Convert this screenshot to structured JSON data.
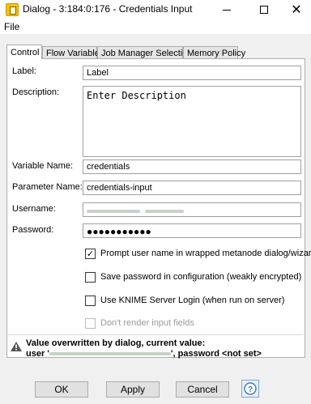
{
  "window": {
    "title": "Dialog - 3:184:0:176 - Credentials Input"
  },
  "menu": {
    "file": "File"
  },
  "tabs": [
    {
      "label": "Control"
    },
    {
      "label": "Flow Variables"
    },
    {
      "label": "Job Manager Selection"
    },
    {
      "label": "Memory Policy"
    }
  ],
  "form": {
    "label": {
      "label": "Label:",
      "value": "Label"
    },
    "description": {
      "label": "Description:",
      "value": "Enter Description"
    },
    "variable_name": {
      "label": "Variable Name:",
      "value": "credentials"
    },
    "parameter_name": {
      "label": "Parameter Name:",
      "value": "credentials-input"
    },
    "username": {
      "label": "Username:"
    },
    "password": {
      "label": "Password:",
      "value": "●●●●●●●●●●●"
    }
  },
  "options": [
    {
      "label": "Prompt user name in wrapped metanode dialog/wizard",
      "checked": true,
      "disabled": false
    },
    {
      "label": "Save password in configuration (weakly encrypted)",
      "checked": false,
      "disabled": false
    },
    {
      "label": "Use KNIME Server Login (when run on server)",
      "checked": false,
      "disabled": false
    },
    {
      "label": "Don't render input fields",
      "checked": false,
      "disabled": true
    }
  ],
  "warning": {
    "line1": "Value overwritten by dialog, current value:",
    "prefix": "user '",
    "suffix": "', password <not set>"
  },
  "buttons": {
    "ok": "OK",
    "apply": "Apply",
    "cancel": "Cancel"
  },
  "icons": {
    "app": "dialog-app-icon",
    "warning": "warning-triangle-icon",
    "help": "help-question-icon"
  }
}
